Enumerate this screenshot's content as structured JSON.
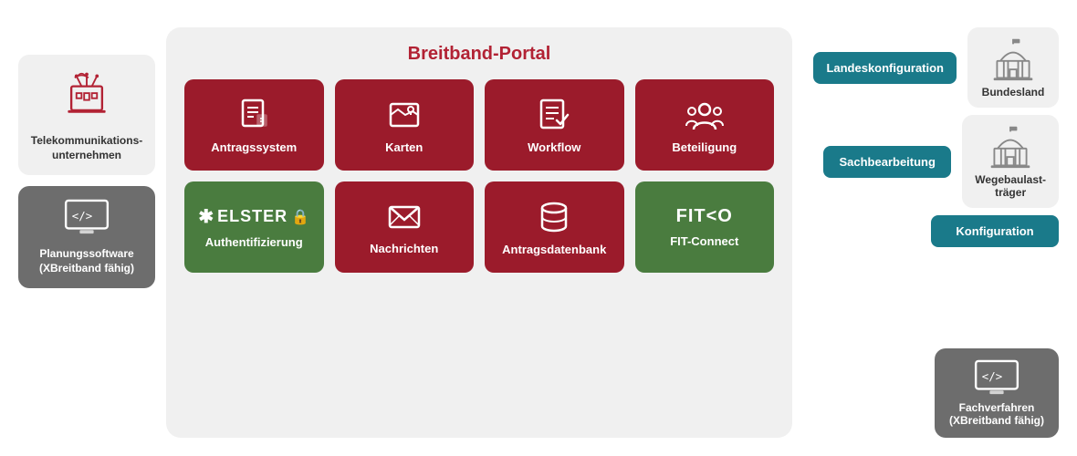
{
  "left": {
    "telecom": {
      "label": "Telekommunikations-\nunternehmen"
    },
    "planning": {
      "label": "Planungssoftware\n(XBreitband fähig)"
    }
  },
  "center": {
    "title": "Breitband-Portal",
    "cards_row1": [
      {
        "id": "antragssystem",
        "label": "Antragssystem",
        "icon": "doc"
      },
      {
        "id": "karten",
        "label": "Karten",
        "icon": "map"
      },
      {
        "id": "workflow",
        "label": "Workflow",
        "icon": "checklist"
      },
      {
        "id": "beteiligung",
        "label": "Beteiligung",
        "icon": "people"
      }
    ],
    "cards_row2": [
      {
        "id": "auth",
        "label": "Authentifizierung",
        "icon": "elster",
        "green": true
      },
      {
        "id": "nachrichten",
        "label": "Nachrichten",
        "icon": "mail"
      },
      {
        "id": "antragsdatenbank",
        "label": "Antragsdatenbank",
        "icon": "db"
      },
      {
        "id": "fitconnect",
        "label": "FIT-Connect",
        "icon": "fitco",
        "green": true
      }
    ]
  },
  "right": {
    "landeskonfiguration": "Landeskonfiguration",
    "sachbearbeitung": "Sachbearbeitung",
    "konfiguration": "Konfiguration",
    "bundesland": "Bundesland",
    "wegebaulast": "Wegebaulast-\nträger",
    "fachverfahren": "Fachverfahren\n(XBreitband fähig)"
  }
}
